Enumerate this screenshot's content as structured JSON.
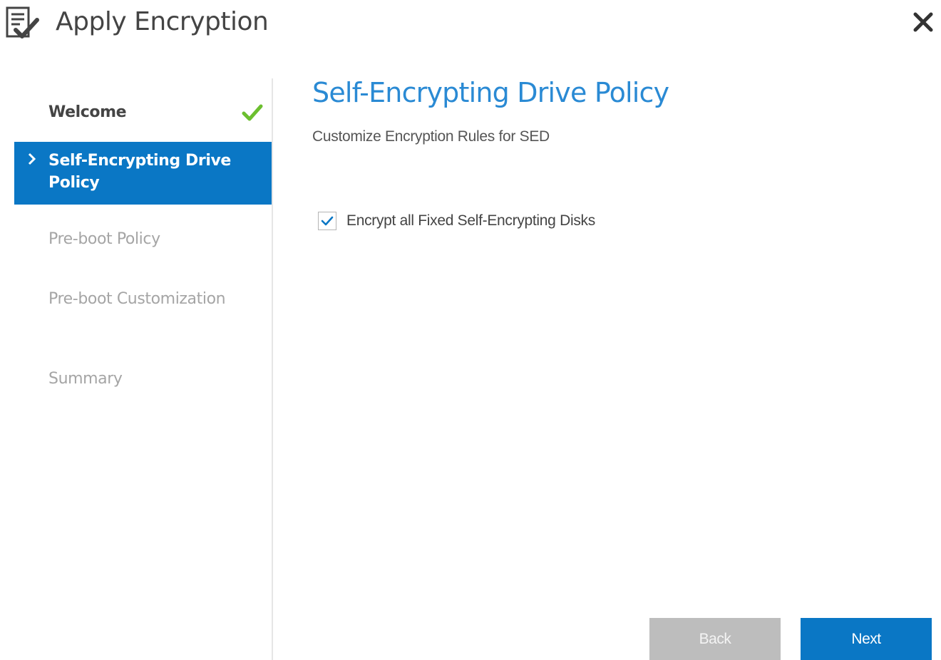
{
  "window": {
    "title": "Apply Encryption",
    "icon": "document-check-icon",
    "close_icon": "close-icon"
  },
  "sidebar": {
    "steps": [
      {
        "label": "Welcome",
        "state": "completed"
      },
      {
        "label": "Self-Encrypting Drive Policy",
        "state": "active"
      },
      {
        "label": "Pre-boot Policy",
        "state": "pending"
      },
      {
        "label": "Pre-boot Customization",
        "state": "pending"
      },
      {
        "label": "Summary",
        "state": "pending"
      }
    ]
  },
  "main": {
    "title": "Self-Encrypting Drive Policy",
    "subtitle": "Customize Encryption Rules for SED",
    "options": [
      {
        "label": "Encrypt all Fixed Self-Encrypting Disks",
        "checked": true
      }
    ]
  },
  "footer": {
    "back_label": "Back",
    "next_label": "Next"
  },
  "colors": {
    "accent": "#0a77c5",
    "heading": "#2a8ad4",
    "check_green": "#6cbf2f",
    "disabled_button": "#bdbdbd"
  }
}
